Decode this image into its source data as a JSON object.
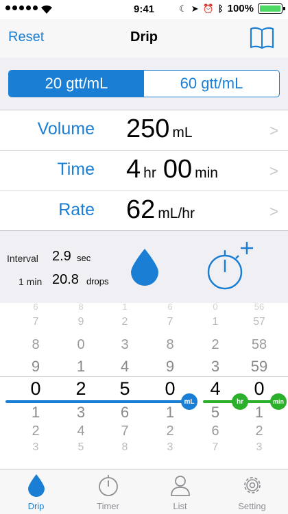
{
  "status": {
    "time": "9:41",
    "battery": "100%"
  },
  "nav": {
    "reset": "Reset",
    "title": "Drip"
  },
  "segment": {
    "options": [
      "20 gtt/mL",
      "60 gtt/mL"
    ],
    "selected": 0
  },
  "rows": {
    "volume": {
      "label": "Volume",
      "value": "250",
      "unit": "mL"
    },
    "time": {
      "label": "Time",
      "hours": "4",
      "hr_unit": "hr",
      "minutes": "00",
      "min_unit": "min"
    },
    "rate": {
      "label": "Rate",
      "value": "62",
      "unit": "mL/hr"
    }
  },
  "info": {
    "interval_label": "Interval",
    "interval_value": "2.9",
    "interval_unit": "sec",
    "min_label": "1 min",
    "min_value": "20.8",
    "min_unit": "drops"
  },
  "picker": {
    "columns": [
      {
        "values": [
          "6",
          "7",
          "8",
          "9",
          "0",
          "1",
          "2",
          "3"
        ],
        "selected": "0"
      },
      {
        "values": [
          "8",
          "9",
          "0",
          "1",
          "2",
          "3",
          "4",
          "5"
        ],
        "selected": "2"
      },
      {
        "values": [
          "1",
          "2",
          "3",
          "4",
          "5",
          "6",
          "7",
          "8"
        ],
        "selected": "5"
      },
      {
        "values": [
          "6",
          "7",
          "8",
          "9",
          "0",
          "1",
          "2",
          "3"
        ],
        "selected": "0"
      },
      {
        "values": [
          "0",
          "1",
          "2",
          "3",
          "4",
          "5",
          "6",
          "7"
        ],
        "selected": "4"
      },
      {
        "values": [
          "56",
          "57",
          "58",
          "59",
          "0",
          "1",
          "2",
          "3"
        ],
        "selected": "0"
      }
    ],
    "badges": {
      "ml": "mL",
      "hr": "hr",
      "min": "min"
    },
    "colors": {
      "volume": "#1a7fd4",
      "time": "#2bb02b"
    }
  },
  "tabs": [
    {
      "label": "Drip",
      "icon": "drop-icon"
    },
    {
      "label": "Timer",
      "icon": "stopwatch-icon"
    },
    {
      "label": "List",
      "icon": "person-icon"
    },
    {
      "label": "Setting",
      "icon": "gear-icon"
    }
  ],
  "active_tab": 0
}
